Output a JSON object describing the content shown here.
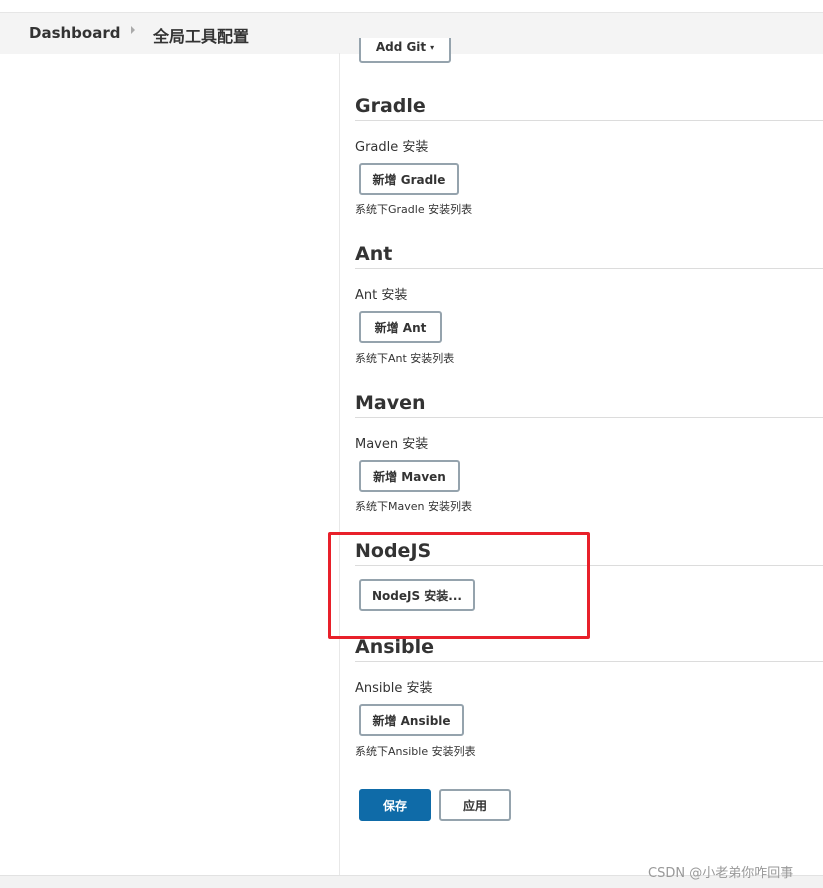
{
  "breadcrumb": {
    "home": "Dashboard",
    "current": "全局工具配置"
  },
  "git": {
    "add_button": "Add Git"
  },
  "gradle": {
    "title": "Gradle",
    "install_label": "Gradle 安装",
    "add_button": "新增 Gradle",
    "help": "系统下Gradle 安装列表"
  },
  "ant": {
    "title": "Ant",
    "install_label": "Ant 安装",
    "add_button": "新增 Ant",
    "help": "系统下Ant 安装列表"
  },
  "maven": {
    "title": "Maven",
    "install_label": "Maven 安装",
    "add_button": "新增 Maven",
    "help": "系统下Maven 安装列表"
  },
  "nodejs": {
    "title": "NodeJS",
    "install_button": "NodeJS 安装..."
  },
  "ansible": {
    "title": "Ansible",
    "install_label": "Ansible 安装",
    "add_button": "新增 Ansible",
    "help": "系统下Ansible 安装列表"
  },
  "actions": {
    "save": "保存",
    "apply": "应用"
  },
  "watermark": "CSDN @小老弟你咋回事",
  "colors": {
    "primary": "#0f6ba8",
    "highlight": "#e8202a"
  }
}
